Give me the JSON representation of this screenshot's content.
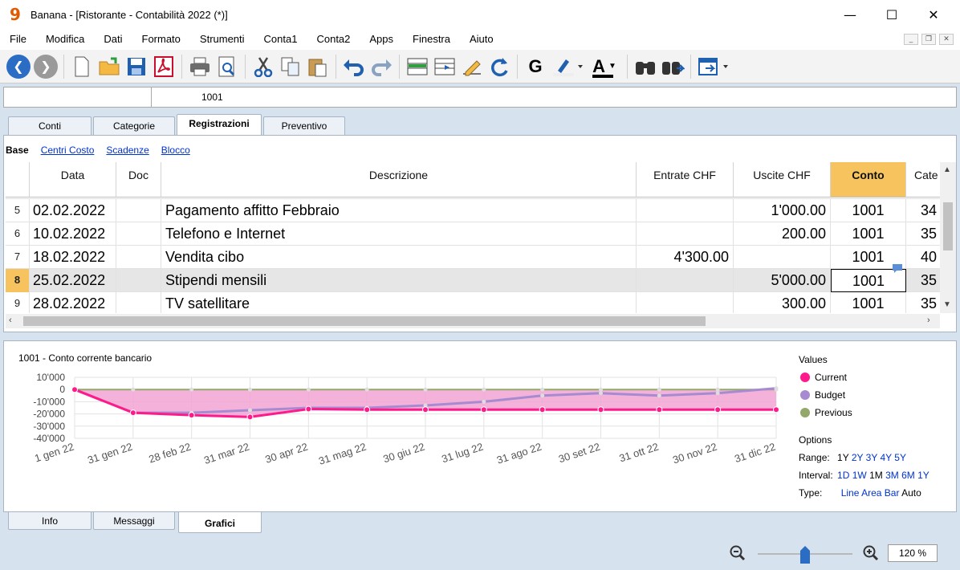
{
  "window": {
    "title": "Banana - [Ristorante - Contabilità 2022 (*)]",
    "logo": "9"
  },
  "menu": [
    "File",
    "Modifica",
    "Dati",
    "Formato",
    "Strumenti",
    "Conta1",
    "Conta2",
    "Apps",
    "Finestra",
    "Aiuto"
  ],
  "toolbar": {
    "icons": [
      "back-icon",
      "forward-icon",
      "new-file-icon",
      "open-folder-icon",
      "save-icon",
      "pdf-icon",
      "print-icon",
      "print-preview-icon",
      "cut-icon",
      "copy-icon",
      "paste-icon",
      "undo-icon",
      "redo-icon",
      "insert-row-icon",
      "move-row-icon",
      "edit-icon",
      "refresh-icon",
      "bold-icon",
      "highlight-icon",
      "font-color-icon",
      "find-icon",
      "find-next-icon",
      "window-icon"
    ],
    "bold_label": "G",
    "font_color_label": "A"
  },
  "cellbar": {
    "address": "",
    "value": "1001"
  },
  "tabs": [
    "Conti",
    "Categorie",
    "Registrazioni",
    "Preventivo"
  ],
  "active_tab": "Registrazioni",
  "subtabs": [
    "Base",
    "Centri Costo",
    "Scadenze",
    "Blocco"
  ],
  "grid": {
    "columns": [
      "Data",
      "Doc",
      "Descrizione",
      "Entrate CHF",
      "Uscite CHF",
      "Conto",
      "Cate"
    ],
    "rows": [
      {
        "n": "5",
        "date": "02.02.2022",
        "doc": "",
        "desc": "Pagamento affitto Febbraio",
        "in": "",
        "out": "1'000.00",
        "conto": "1001",
        "cat": "34"
      },
      {
        "n": "6",
        "date": "10.02.2022",
        "doc": "",
        "desc": "Telefono e Internet",
        "in": "",
        "out": "200.00",
        "conto": "1001",
        "cat": "35"
      },
      {
        "n": "7",
        "date": "18.02.2022",
        "doc": "",
        "desc": "Vendita cibo",
        "in": "4'300.00",
        "out": "",
        "conto": "1001",
        "cat": "40"
      },
      {
        "n": "8",
        "date": "25.02.2022",
        "doc": "",
        "desc": "Stipendi mensili",
        "in": "",
        "out": "5'000.00",
        "conto": "1001",
        "cat": "35"
      },
      {
        "n": "9",
        "date": "28.02.2022",
        "doc": "",
        "desc": "TV satellitare",
        "in": "",
        "out": "300.00",
        "conto": "1001",
        "cat": "35"
      }
    ]
  },
  "chart_data": {
    "type": "line",
    "title": "1001 - Conto corrente bancario",
    "categories": [
      "1 gen 22",
      "31 gen 22",
      "28 feb 22",
      "31 mar 22",
      "30 apr 22",
      "31 mag 22",
      "30 giu 22",
      "31 lug 22",
      "31 ago 22",
      "30 set 22",
      "31 ott 22",
      "30 nov 22",
      "31 dic 22"
    ],
    "yticks": [
      "10'000",
      "0",
      "-10'000",
      "-20'000",
      "-30'000",
      "-40'000"
    ],
    "ylim": [
      -40000,
      10000
    ],
    "series": [
      {
        "name": "Current",
        "color": "#ff1a8c",
        "values": [
          0,
          -19000,
          -21000,
          -22500,
          -16000,
          -16500,
          -16500,
          -16500,
          -16500,
          -16500,
          -16500,
          -16500,
          -16500
        ]
      },
      {
        "name": "Budget",
        "color": "#a78bd1",
        "values": [
          0,
          -19000,
          -19000,
          -17000,
          -15000,
          -15000,
          -13000,
          -10000,
          -5000,
          -3000,
          -5000,
          -3000,
          1000
        ]
      },
      {
        "name": "Previous",
        "color": "#93a86a",
        "values": [
          0,
          0,
          0,
          0,
          0,
          0,
          0,
          0,
          0,
          0,
          0,
          0,
          0
        ]
      }
    ],
    "legend_title": "Values",
    "legend_position": "right"
  },
  "options": {
    "title": "Options",
    "range_label": "Range:",
    "range": [
      "1Y",
      "2Y",
      "3Y",
      "4Y",
      "5Y"
    ],
    "interval_label": "Interval:",
    "interval": [
      "1D",
      "1W",
      "1M",
      "3M",
      "6M",
      "1Y"
    ],
    "type_label": "Type:",
    "type": [
      "Line",
      "Area",
      "Bar",
      "Auto"
    ]
  },
  "bottom_tabs": [
    "Info",
    "Messaggi",
    "Grafici"
  ],
  "zoom": {
    "value": "120 %",
    "level": 0.5
  }
}
